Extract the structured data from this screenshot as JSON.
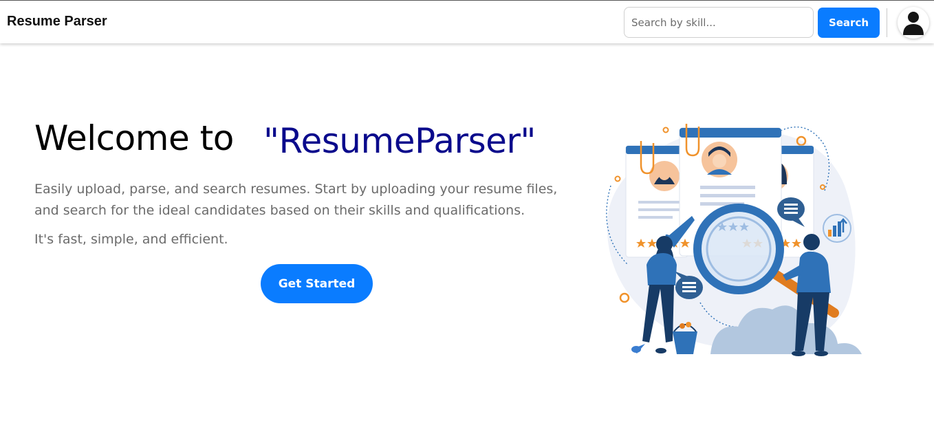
{
  "navbar": {
    "brand": "Resume Parser",
    "search_placeholder": "Search by skill...",
    "search_button": "Search",
    "avatar_icon": "user-icon"
  },
  "hero": {
    "title": "Welcome to",
    "brand": "\"ResumeParser\"",
    "description": "Easily upload, parse, and search resumes. Start by uploading your resume files, and search for the ideal candidates based on their skills and qualifications.",
    "tagline": "It's fast, simple, and efficient.",
    "cta_button": "Get Started"
  },
  "illustration": {
    "icon": "resume-search-illustration"
  },
  "colors": {
    "primary": "#0a7cff",
    "brand_text": "#0a0a8c",
    "muted_text": "#6b6b6b",
    "illustration_blue": "#2f72b8",
    "illustration_orange": "#f0922b"
  }
}
